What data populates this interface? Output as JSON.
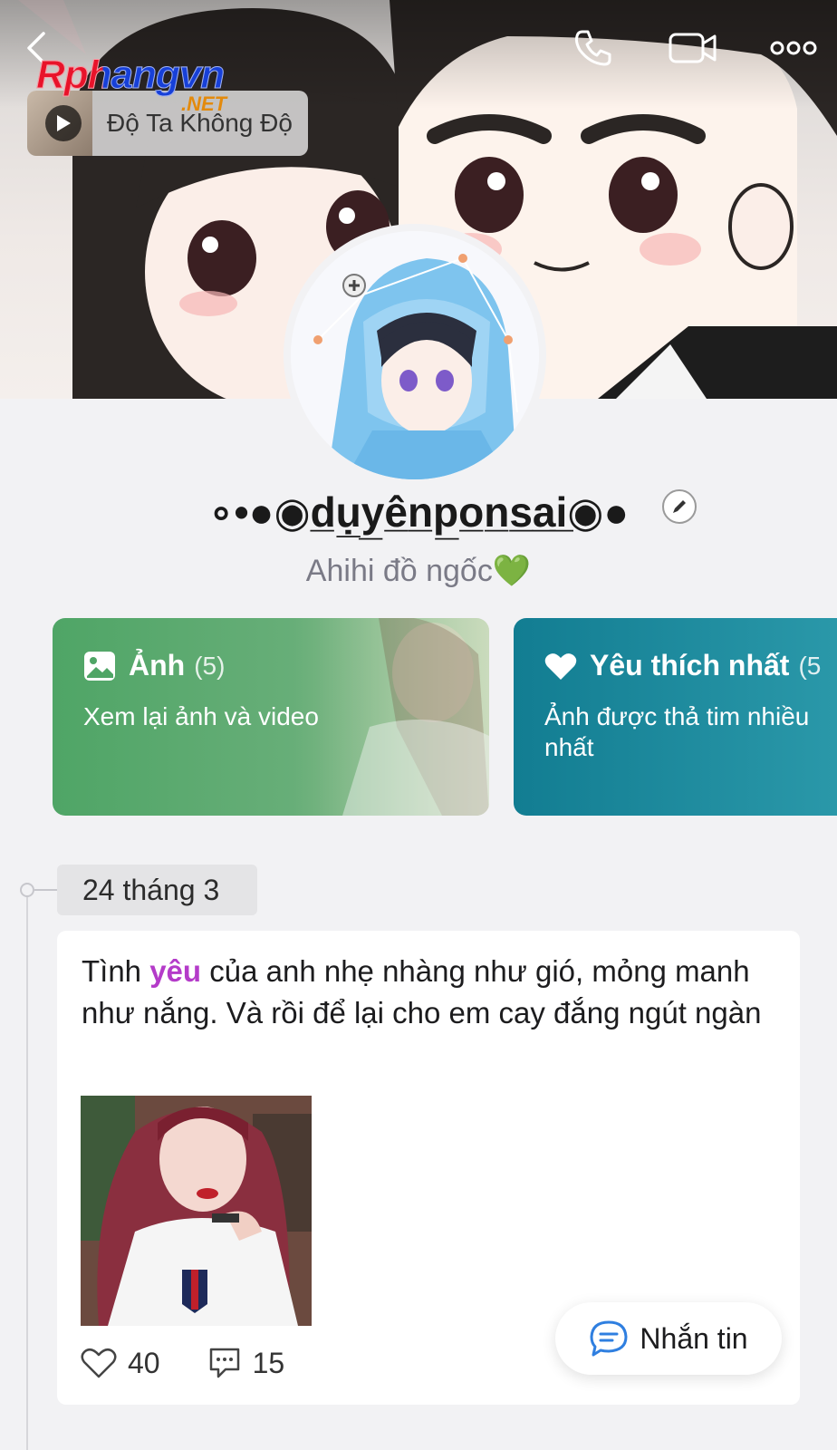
{
  "watermark": {
    "main": "Rphangvn",
    "sub": ".NET"
  },
  "music": {
    "title": "Độ Ta Không Độ"
  },
  "profile": {
    "name": "∘•●◉d̲ụ̲y̲ê̲n̲p̲o̲n̲s̲a̲i̲◉●",
    "bio": "Ahihi đồ ngốc💚"
  },
  "cards": {
    "photos": {
      "title": "Ảnh",
      "count": "(5)",
      "subtitle": "Xem lại ảnh và video"
    },
    "favorites": {
      "title": "Yêu thích nhất",
      "count": "(5",
      "subtitle": "Ảnh được thả tim nhiều nhất"
    }
  },
  "timeline": {
    "date": "24 tháng 3",
    "post": {
      "text_before": "Tình ",
      "highlight": "yêu",
      "text_after": " của anh nhẹ nhàng như gió, mỏng manh như nắng. Và rồi để lại cho em cay đắng ngút ngàn",
      "likes": "40",
      "comments": "15"
    }
  },
  "fab": {
    "label": "Nhắn tin"
  },
  "colors": {
    "photos_card": "#4fa566",
    "favorites_card": "#127d92",
    "highlight": "#b43bc9",
    "fab_icon": "#2f7fe0"
  },
  "icons": [
    "back-icon",
    "phone-icon",
    "video-call-icon",
    "more-icon",
    "play-icon",
    "edit-pencil-icon",
    "image-icon",
    "heart-icon",
    "comment-icon",
    "chat-icon"
  ]
}
